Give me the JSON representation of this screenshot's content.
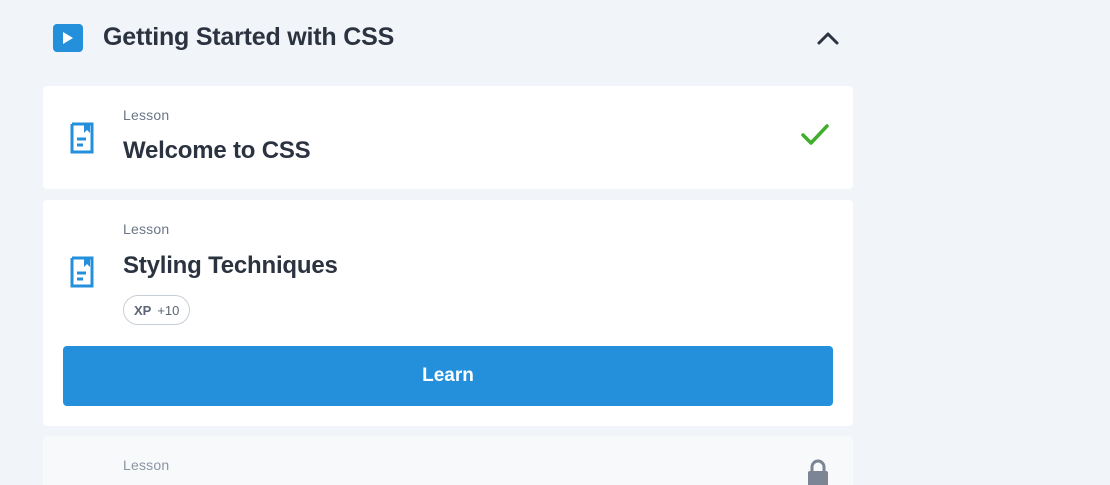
{
  "module": {
    "title": "Getting Started with CSS",
    "accent_color": "#2490dc",
    "expanded": true
  },
  "lessons": [
    {
      "kicker": "Lesson",
      "title": "Welcome to CSS",
      "status": "completed",
      "icon": "lesson-document-icon",
      "status_icon": "check-icon",
      "status_color": "#3fae2a"
    },
    {
      "kicker": "Lesson",
      "title": "Styling Techniques",
      "status": "current",
      "icon": "lesson-document-icon",
      "xp_label": "XP",
      "xp_value": "+10",
      "button_label": "Learn"
    },
    {
      "kicker": "Lesson",
      "title": "",
      "status": "locked",
      "status_icon": "lock-icon"
    }
  ]
}
